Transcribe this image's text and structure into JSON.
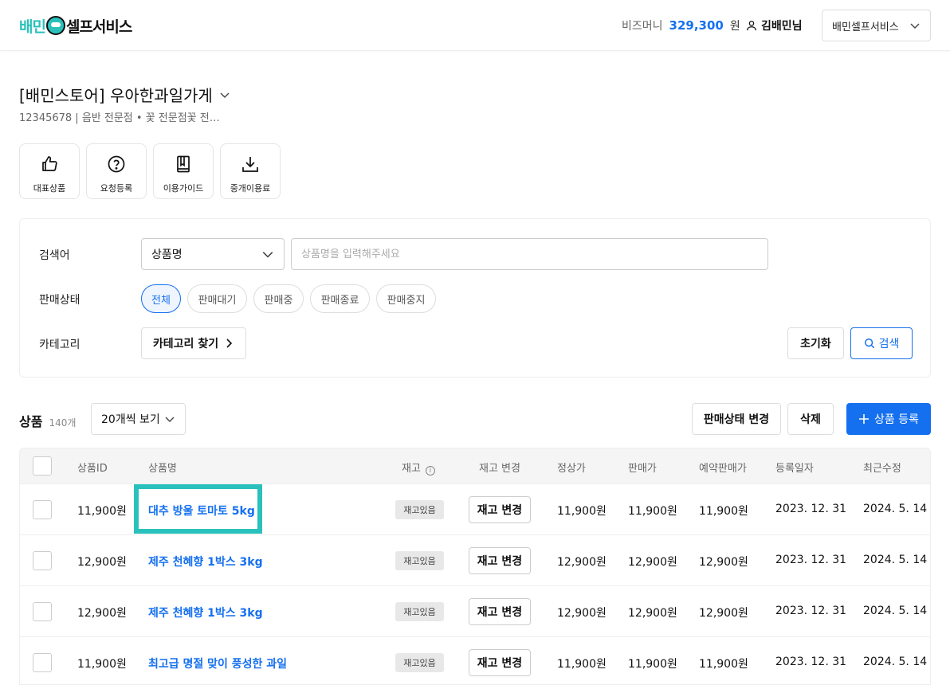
{
  "header": {
    "logo_part1": "배민",
    "logo_part2": "셀프서비스",
    "bizmoney_label": "비즈머니",
    "bizmoney_amount": "329,300",
    "bizmoney_unit": "원",
    "user_name": "김배민님",
    "service_select": "배민셀프서비스"
  },
  "store": {
    "title": "[배민스토어] 우아한과일가게",
    "meta": "12345678 | 음반 전문점 • 꽃 전문점꽃 전…"
  },
  "shortcuts": [
    {
      "label": "대표상품",
      "icon": "thumbs-up-icon"
    },
    {
      "label": "요청등록",
      "icon": "question-circle-icon"
    },
    {
      "label": "이용가이드",
      "icon": "book-icon"
    },
    {
      "label": "중개이용료",
      "icon": "download-icon"
    }
  ],
  "search": {
    "keyword_label": "검색어",
    "field_select": "상품명",
    "placeholder": "상품명을 입력해주세요",
    "status_label": "판매상태",
    "status_options": [
      "전체",
      "판매대기",
      "판매중",
      "판매종료",
      "판매중지"
    ],
    "category_label": "카테고리",
    "category_button": "카테고리 찾기",
    "reset_button": "초기화",
    "search_button": "검색"
  },
  "products": {
    "title": "상품",
    "count": "140개",
    "page_size": "20개씩 보기",
    "status_change_button": "판매상태 변경",
    "delete_button": "삭제",
    "add_button": "상품 등록",
    "columns": [
      "상품ID",
      "상품명",
      "재고",
      "재고 변경",
      "정상가",
      "판매가",
      "예약판매가",
      "등록일자",
      "최근수정"
    ],
    "rows": [
      {
        "id": "11,900원",
        "name": "대추 방울 토마토 5kg",
        "stock": "재고있음",
        "stock_btn": "재고 변경",
        "regular": "11,900원",
        "sale": "11,900원",
        "reserve": "11,900원",
        "registered": "2023. 12. 31",
        "modified": "2024. 5. 14"
      },
      {
        "id": "12,900원",
        "name": "제주 천혜향 1박스 3kg",
        "stock": "재고있음",
        "stock_btn": "재고 변경",
        "regular": "12,900원",
        "sale": "12,900원",
        "reserve": "12,900원",
        "registered": "2023. 12. 31",
        "modified": "2024. 5. 14"
      },
      {
        "id": "12,900원",
        "name": "제주 천혜향 1박스 3kg",
        "stock": "재고있음",
        "stock_btn": "재고 변경",
        "regular": "12,900원",
        "sale": "12,900원",
        "reserve": "12,900원",
        "registered": "2023. 12. 31",
        "modified": "2024. 5. 14"
      },
      {
        "id": "11,900원",
        "name": "최고급 명절 맞이 풍성한 과일",
        "stock": "재고있음",
        "stock_btn": "재고 변경",
        "regular": "11,900원",
        "sale": "11,900원",
        "reserve": "11,900원",
        "registered": "2023. 12. 31",
        "modified": "2024. 5. 14"
      }
    ]
  },
  "colors": {
    "brand_mint": "#2ac1bc",
    "accent_blue": "#1570ef"
  }
}
